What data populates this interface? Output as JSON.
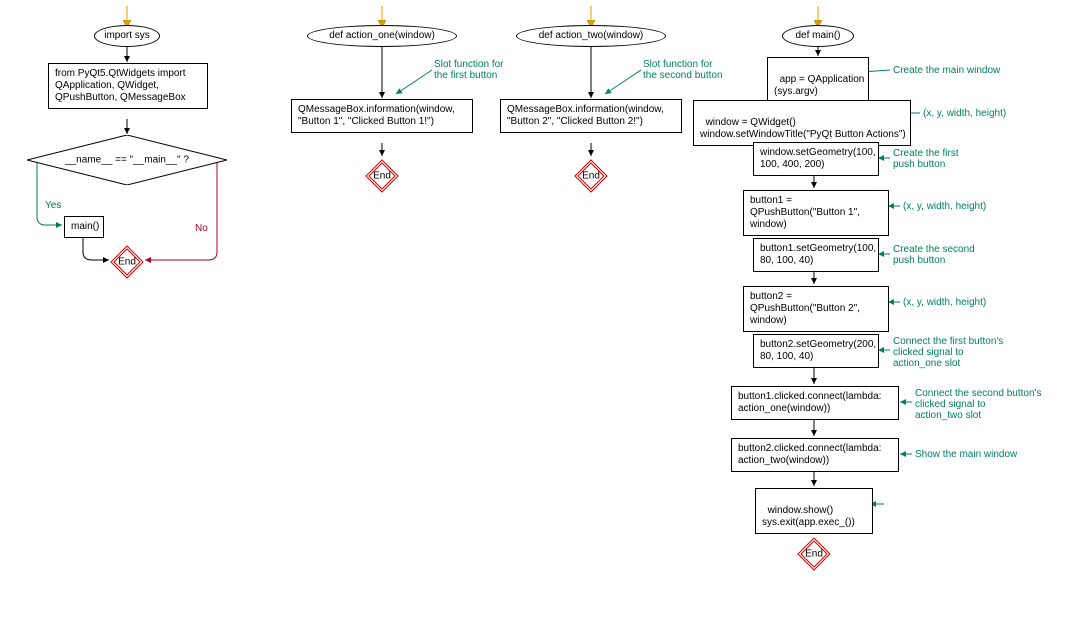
{
  "colors": {
    "line": "#000000",
    "yes": "#007f3f",
    "no": "#b00020",
    "annot": "#008060",
    "end_red": "#d40000",
    "start_arrow": "#e0a000"
  },
  "col1": {
    "start_import": "import sys",
    "import_box": "from PyQt5.QtWidgets import QApplication, QWidget, QPushButton, QMessageBox",
    "decision": "__name__ == \"__main__\"  ?",
    "yes": "Yes",
    "no": "No",
    "main_call": "main()",
    "end": "End"
  },
  "col2": {
    "def": "def action_one(window)",
    "annot": "Slot function for\nthe first button",
    "body": "QMessageBox.information(window, \"Button 1\", \"Clicked Button 1!\")",
    "end": "End"
  },
  "col3": {
    "def": "def action_two(window)",
    "annot": "Slot function for\nthe second button",
    "body": "QMessageBox.information(window, \"Button 2\", \"Clicked Button 2!\")",
    "end": "End"
  },
  "col4": {
    "def": "def main()",
    "s1": "app = QApplication\n(sys.argv)",
    "a1": "Create the main window",
    "s2": "window = QWidget()\nwindow.setWindowTitle(\"PyQt Button Actions\")",
    "a2": "(x, y, width, height)",
    "s3": "window.setGeometry(100, 100, 400, 200)",
    "a3": "Create the first\npush button",
    "s4": "button1 = QPushButton(\"Button 1\", window)",
    "a4": "(x, y, width, height)",
    "s5": "button1.setGeometry(100, 80, 100, 40)",
    "a5": "Create the second\npush button",
    "s6": "button2 = QPushButton(\"Button 2\", window)",
    "a6": "(x, y, width, height)",
    "s7": "button2.setGeometry(200, 80, 100, 40)",
    "a7": "Connect the first button's\nclicked signal to\naction_one slot",
    "s8": "button1.clicked.connect(lambda: action_one(window))",
    "a8": "Connect the second button's\nclicked signal to\naction_two slot",
    "s9": "button2.clicked.connect(lambda: action_two(window))",
    "a9": "Show the main window",
    "s10": "window.show()\nsys.exit(app.exec_())",
    "end": "End"
  }
}
